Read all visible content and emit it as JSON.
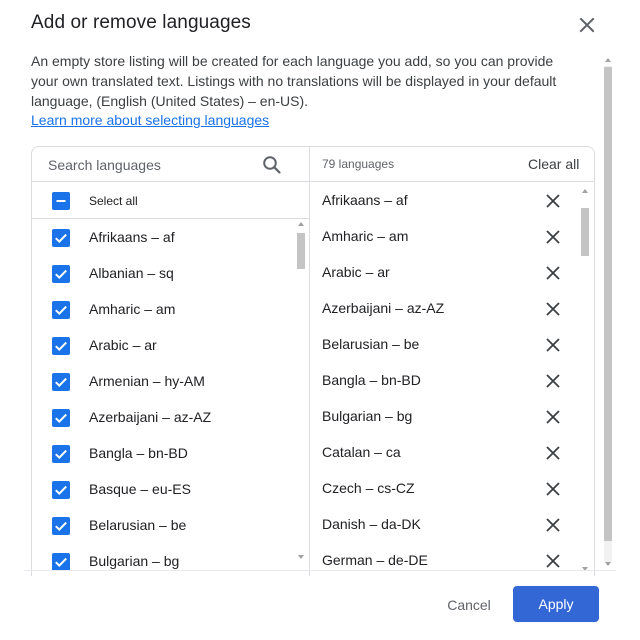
{
  "dialog": {
    "title": "Add or remove languages",
    "intro": "An empty store listing will be created for each language you add, so you can provide your own translated text. Listings with no translations will be displayed in your default language, (English (United States) – en-US).",
    "learn_more": "Learn more about selecting languages"
  },
  "search": {
    "placeholder": "Search languages",
    "icon": "search-icon"
  },
  "select_all": {
    "label": "Select all",
    "state": "indeterminate"
  },
  "available": [
    {
      "label": "Afrikaans – af",
      "checked": true
    },
    {
      "label": "Albanian – sq",
      "checked": true
    },
    {
      "label": "Amharic – am",
      "checked": true
    },
    {
      "label": "Arabic – ar",
      "checked": true
    },
    {
      "label": "Armenian – hy-AM",
      "checked": true
    },
    {
      "label": "Azerbaijani – az-AZ",
      "checked": true
    },
    {
      "label": "Bangla – bn-BD",
      "checked": true
    },
    {
      "label": "Basque – eu-ES",
      "checked": true
    },
    {
      "label": "Belarusian – be",
      "checked": true
    },
    {
      "label": "Bulgarian – bg",
      "checked": true
    }
  ],
  "selected": {
    "count_label": "79 languages",
    "clear_all": "Clear all",
    "items": [
      "Afrikaans – af",
      "Amharic – am",
      "Arabic – ar",
      "Azerbaijani – az-AZ",
      "Belarusian – be",
      "Bangla – bn-BD",
      "Bulgarian – bg",
      "Catalan – ca",
      "Czech – cs-CZ",
      "Danish – da-DK",
      "German – de-DE"
    ]
  },
  "footer": {
    "cancel": "Cancel",
    "apply": "Apply"
  },
  "colors": {
    "accent": "#1a73e8",
    "apply_bg": "#3367d6"
  }
}
